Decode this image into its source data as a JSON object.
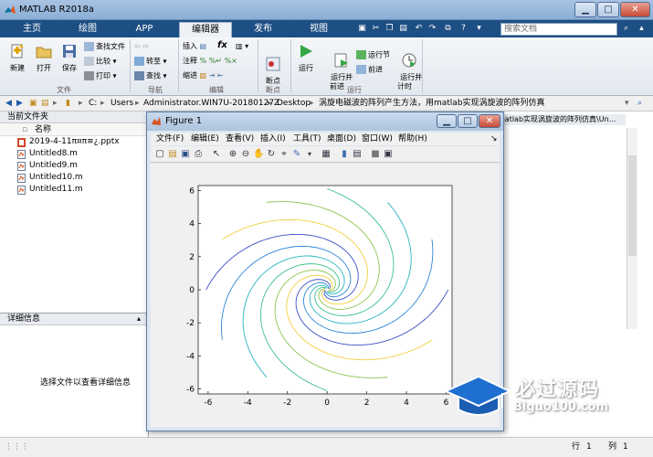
{
  "window": {
    "title": "MATLAB R2018a"
  },
  "tabs": [
    {
      "label": "主页"
    },
    {
      "label": "绘图"
    },
    {
      "label": "APP"
    },
    {
      "label": "编辑器"
    },
    {
      "label": "发布"
    },
    {
      "label": "视图"
    }
  ],
  "search": {
    "placeholder": "搜索文档"
  },
  "ribbon": {
    "file": {
      "new": "新建",
      "open": "打开",
      "save": "保存",
      "find_files": "查找文件",
      "compare": "比较",
      "print": "打印",
      "group": "文件"
    },
    "nav": {
      "goto": "转至",
      "find": "查找",
      "group": "导航"
    },
    "edit": {
      "insert": "插入",
      "comment": "注释",
      "indent": "缩进",
      "fx": "fx",
      "group": "编辑"
    },
    "breakpoints": {
      "label": "断点",
      "group": "断点"
    },
    "run": {
      "run": "运行",
      "run_and_advance": "运行并\n前进",
      "run_section": "运行节",
      "advance": "前进",
      "run_and_time": "运行并\n计时",
      "group": "运行"
    }
  },
  "path": {
    "segments": [
      "C:",
      "Users",
      "Administrator.WIN7U-20180127Z",
      "Desktop",
      "涡旋电磁波的阵列产生方法，用matlab实现涡旋波的阵列仿真"
    ]
  },
  "file_panel": {
    "title": "当前文件夹",
    "column": "名称",
    "files": [
      "2019-4-11π¤π≡¿.pptx",
      "Untitled8.m",
      "Untitled9.m",
      "Untitled10.m",
      "Untitled11.m"
    ]
  },
  "detail_panel": {
    "title": "详细信息",
    "message": "选择文件以查看详细信息"
  },
  "command_title": "matlab实现涡旋波的阵列仿真\\Un...",
  "status": {
    "row_label": "行",
    "row": "1",
    "col_label": "列",
    "col": "1"
  },
  "figure": {
    "title": "Figure 1",
    "menu": [
      "文件(F)",
      "编辑(E)",
      "查看(V)",
      "插入(I)",
      "工具(T)",
      "桌面(D)",
      "窗口(W)",
      "帮助(H)"
    ]
  },
  "chart_data": {
    "type": "line",
    "title": "",
    "xlabel": "",
    "ylabel": "",
    "xlim": [
      -6.5,
      6.3
    ],
    "ylim": [
      -6.3,
      6.3
    ],
    "xticks": [
      -6,
      -4,
      -2,
      0,
      2,
      4,
      6
    ],
    "yticks": [
      -6,
      -4,
      -2,
      0,
      2,
      4,
      6
    ],
    "grid": false,
    "arms": 12,
    "series_colors": [
      "#3b4fc4",
      "#2f86d8",
      "#2ab4c0",
      "#3cc08a",
      "#8cc450",
      "#f0d040"
    ]
  },
  "watermark": {
    "text": "必过源码",
    "url": "Biguo100.com"
  }
}
